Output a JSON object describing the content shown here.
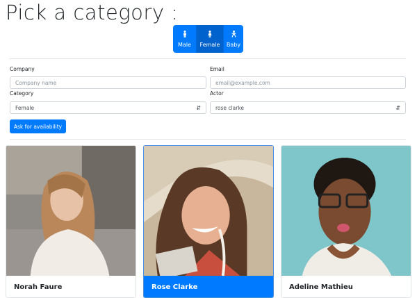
{
  "page": {
    "title": "Pick a category :"
  },
  "categories": [
    {
      "label": "Male",
      "icon": "male-icon",
      "active": false
    },
    {
      "label": "Female",
      "icon": "female-icon",
      "active": true
    },
    {
      "label": "Baby",
      "icon": "baby-icon",
      "active": false
    }
  ],
  "form": {
    "company": {
      "label": "Company",
      "placeholder": "Company name",
      "value": ""
    },
    "email": {
      "label": "Email",
      "placeholder": "email@example.com",
      "value": ""
    },
    "category": {
      "label": "Category",
      "value": "Female"
    },
    "actor": {
      "label": "Actor",
      "value": "rose clarke"
    },
    "submit_label": "Ask for availability"
  },
  "actors": [
    {
      "name": "Norah Faure",
      "selected": false
    },
    {
      "name": "Rose Clarke",
      "selected": true
    },
    {
      "name": "Adeline Mathieu",
      "selected": false
    }
  ],
  "colors": {
    "primary": "#007bff",
    "primary_active": "#0062cc",
    "selected_border": "#4a90e2"
  }
}
